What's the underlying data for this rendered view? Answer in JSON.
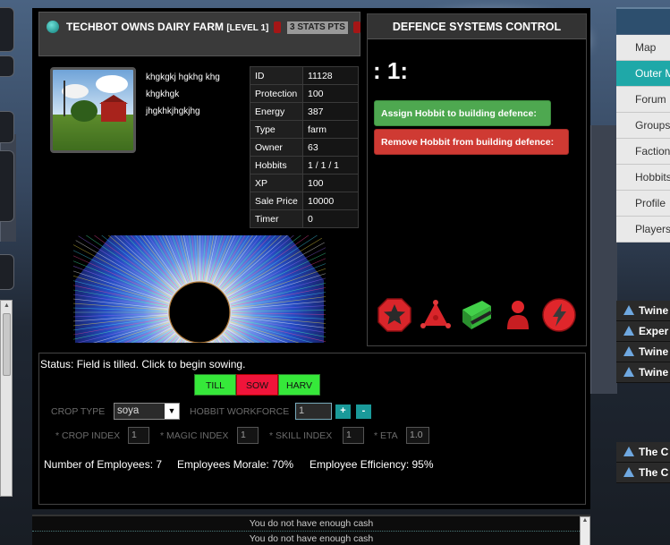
{
  "title": {
    "name": "TECHBOT OWNS DAIRY FARM",
    "level": "[LEVEL 1]",
    "stats_points": "3 STATS PTS"
  },
  "description_lines": [
    "khgkgkj hgkhg khg",
    "khgkhgk",
    "jhgkhkjhgkjhg"
  ],
  "stats": [
    {
      "key": "ID",
      "value": "11128"
    },
    {
      "key": "Protection",
      "value": "100"
    },
    {
      "key": "Energy",
      "value": "387"
    },
    {
      "key": "Type",
      "value": "farm"
    },
    {
      "key": "Owner",
      "value": "63"
    },
    {
      "key": "Hobbits",
      "value": "1 / 1 / 1"
    },
    {
      "key": "XP",
      "value": "100"
    },
    {
      "key": "Sale Price",
      "value": "10000"
    },
    {
      "key": "Timer",
      "value": "0"
    }
  ],
  "defence": {
    "header": "DEFENCE SYSTEMS CONTROL",
    "counter": ": 1:",
    "assign_label": "Assign Hobbit to building defence:",
    "remove_label": "Remove Hobbit from building defence:",
    "icons": [
      "star-octagon-icon",
      "triangle-nodes-icon",
      "green-block-icon",
      "person-icon",
      "lightning-icon"
    ]
  },
  "status": {
    "text": "Status: Field is tilled. Click to begin sowing.",
    "phases": [
      "TILL",
      "SOW",
      "HARV"
    ],
    "crop_type_label": "CROP TYPE",
    "crop_type_value": "soya",
    "workforce_label": "HOBBIT WORKFORCE",
    "workforce_value": "1",
    "plus": "+",
    "minus": "-",
    "crop_index_label": "* CROP INDEX",
    "crop_index_value": "1",
    "magic_index_label": "* MAGIC INDEX",
    "magic_index_value": "1",
    "skill_index_label": "* SKILL INDEX",
    "skill_index_value": "1",
    "eta_label": "* ETA",
    "eta_value": "1.0",
    "employees": "Number of Employees: 7",
    "morale": "Employees Morale: 70%",
    "efficiency": "Employee Efficiency: 95%"
  },
  "messages": [
    "You do not have enough cash",
    "You do not have enough cash"
  ],
  "nav": {
    "items": [
      "Map",
      "Outer M",
      "Forum",
      "Groups",
      "Faction",
      "Hobbits",
      "Profile",
      "Players"
    ],
    "active": "Outer M",
    "threads_a": [
      "Twine",
      "Exper",
      "Twine",
      "Twine"
    ],
    "threads_b": [
      "The C",
      "The C"
    ]
  },
  "colors": {
    "accent": "#1fa8a8",
    "assign": "#4ea850",
    "remove": "#cf3a33",
    "phase_active": "#36e83a",
    "phase_current": "#f0143a"
  }
}
